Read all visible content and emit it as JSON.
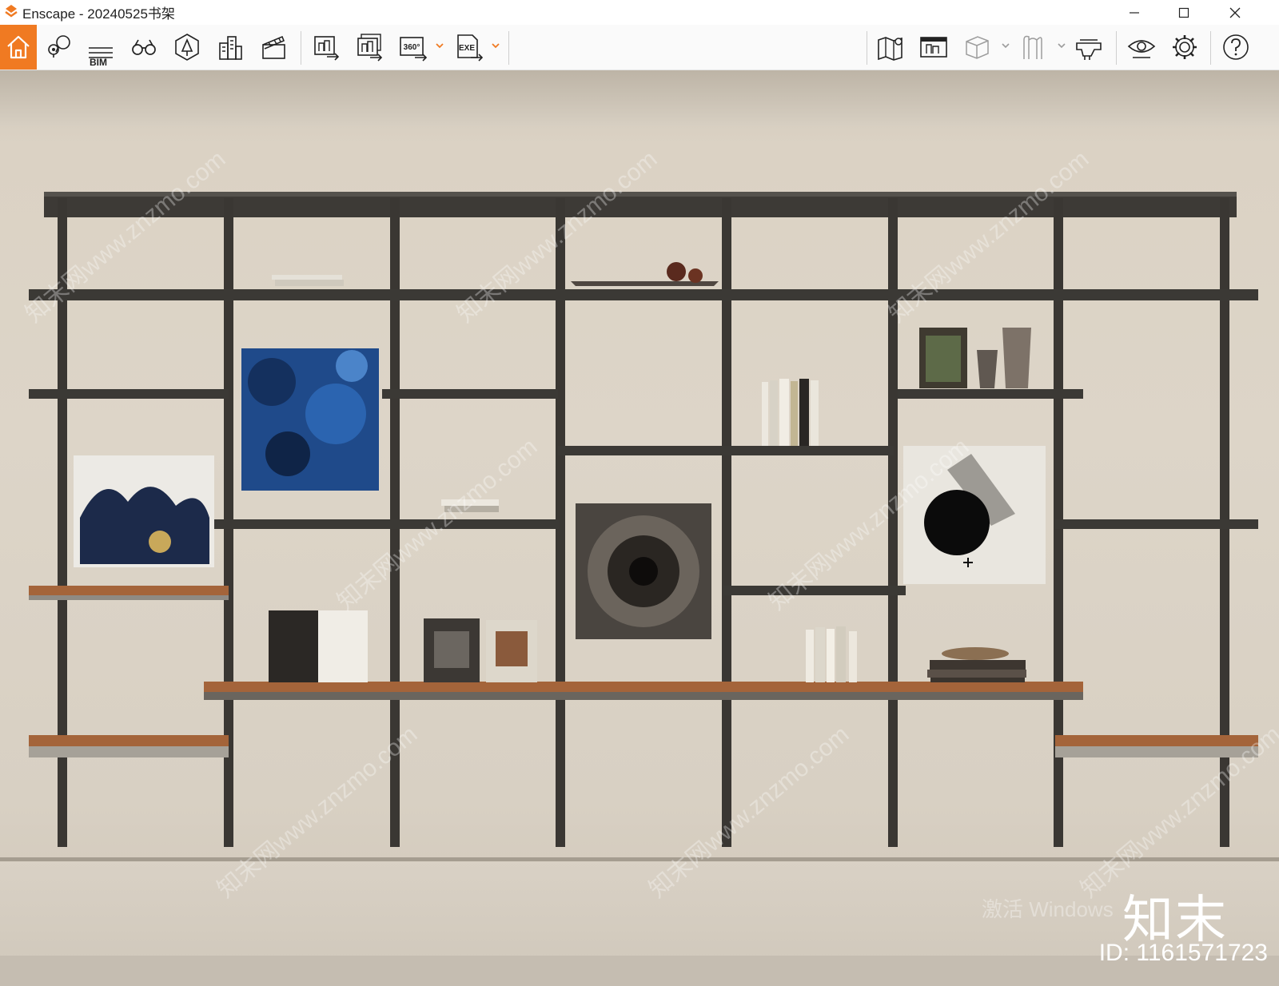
{
  "window": {
    "title": "Enscape - 20240525书架",
    "controls": [
      "minimize",
      "maximize",
      "close"
    ]
  },
  "toolbar": {
    "left_items": [
      {
        "icon": "home-icon"
      },
      {
        "icon": "location-pins-icon"
      },
      {
        "icon": "bim-icon",
        "label": "BIM"
      },
      {
        "icon": "binoculars-icon"
      },
      {
        "icon": "asset-library-icon"
      },
      {
        "icon": "buildings-icon"
      },
      {
        "icon": "clapperboard-icon"
      },
      {
        "icon": "screenshot-export-icon"
      },
      {
        "icon": "batch-render-icon"
      },
      {
        "icon": "panorama-icon",
        "label": "360°"
      },
      {
        "icon": "exe-export-icon",
        "label": "EXE"
      }
    ],
    "right_items": [
      {
        "icon": "map-icon"
      },
      {
        "icon": "minimap-icon"
      },
      {
        "icon": "box-view-icon"
      },
      {
        "icon": "vr-headset-icon"
      },
      {
        "icon": "visual-settings-icon"
      },
      {
        "icon": "view-eye-icon"
      },
      {
        "icon": "settings-gear-icon"
      },
      {
        "icon": "help-icon"
      }
    ],
    "accent_color": "#f07a22"
  },
  "viewport": {
    "watermark_text": "知末网www.znzmo.com",
    "brand": "知末",
    "id_label": "ID: 1161571723",
    "activation_text": "激活 Windows"
  }
}
